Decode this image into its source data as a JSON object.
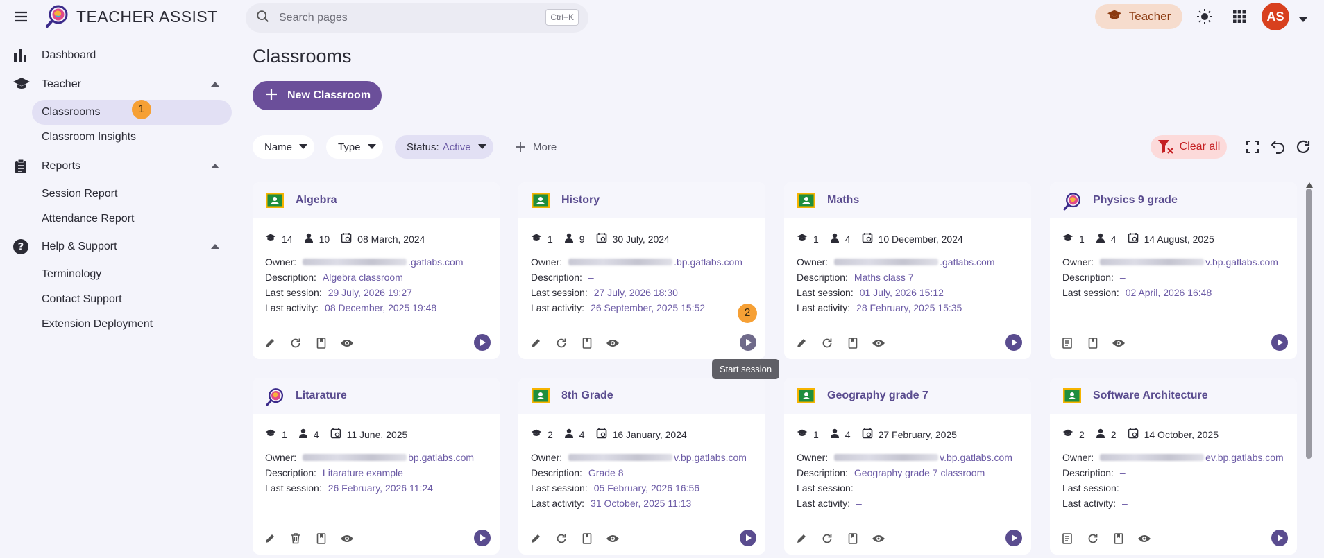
{
  "header": {
    "app_title": "TEACHER ASSIST",
    "search_placeholder": "Search pages",
    "search_shortcut": "Ctrl+K",
    "role_label": "Teacher",
    "avatar_initials": "AS",
    "accent_color": "#6b4f9a",
    "avatar_color": "#d8401e"
  },
  "sidebar": {
    "dashboard": "Dashboard",
    "teacher": "Teacher",
    "classrooms": "Classrooms",
    "classrooms_badge": "1",
    "classroom_insights": "Classroom Insights",
    "reports": "Reports",
    "session_report": "Session Report",
    "attendance_report": "Attendance Report",
    "help": "Help & Support",
    "terminology": "Terminology",
    "contact_support": "Contact Support",
    "extension_deployment": "Extension Deployment"
  },
  "main": {
    "page_title": "Classrooms",
    "new_button": "New Classroom",
    "filters": {
      "name": "Name",
      "type": "Type",
      "status_label": "Status:",
      "status_value": "Active",
      "more": "More",
      "clear_all": "Clear all"
    },
    "tooltip": "Start session",
    "tooltip_badge": "2"
  },
  "labels": {
    "owner": "Owner:",
    "description": "Description:",
    "last_session": "Last session:",
    "last_activity": "Last activity:"
  },
  "cards": [
    {
      "title": "Algebra",
      "type": "google",
      "students": "14",
      "teachers": "10",
      "date": "08 March, 2024",
      "owner_suffix": ".gatlabs.com",
      "description": "Algebra classroom",
      "last_session": "29 July, 2026 19:27",
      "last_activity": "08 December, 2025 19:48",
      "has_activity": true
    },
    {
      "title": "History",
      "type": "google",
      "students": "1",
      "teachers": "9",
      "date": "30 July, 2024",
      "owner_suffix": ".bp.gatlabs.com",
      "description": "–",
      "last_session": "27 July, 2026 18:30",
      "last_activity": "26 September, 2025 15:52",
      "has_activity": true
    },
    {
      "title": "Maths",
      "type": "google",
      "students": "1",
      "teachers": "4",
      "date": "10 December, 2024",
      "owner_suffix": ".gatlabs.com",
      "description": "Maths class 7",
      "last_session": "01 July, 2026 15:12",
      "last_activity": "28 February, 2025 15:35",
      "has_activity": true
    },
    {
      "title": "Physics 9 grade",
      "type": "app",
      "students": "1",
      "teachers": "4",
      "date": "14 August, 2025",
      "owner_suffix": "v.bp.gatlabs.com",
      "description": "–",
      "last_session": "02 April, 2026 16:48",
      "has_activity": false
    },
    {
      "title": "Litarature",
      "type": "app",
      "students": "1",
      "teachers": "4",
      "date": "11 June, 2025",
      "owner_suffix": "bp.gatlabs.com",
      "description": "Litarature example",
      "last_session": "26 February, 2026 11:24",
      "has_activity": false
    },
    {
      "title": "8th Grade",
      "type": "google",
      "students": "2",
      "teachers": "4",
      "date": "16 January, 2024",
      "owner_suffix": "v.bp.gatlabs.com",
      "description": "Grade 8",
      "last_session": "05 February, 2026 16:56",
      "last_activity": "31 October, 2025 11:13",
      "has_activity": true
    },
    {
      "title": "Geography grade 7",
      "type": "google",
      "students": "1",
      "teachers": "4",
      "date": "27 February, 2025",
      "owner_suffix": "v.bp.gatlabs.com",
      "description": "Geography grade 7 classroom",
      "last_session": "–",
      "last_activity": "–",
      "has_activity": true
    },
    {
      "title": "Software Architecture",
      "type": "google",
      "students": "2",
      "teachers": "2",
      "date": "14 October, 2025",
      "owner_suffix": "ev.bp.gatlabs.com",
      "description": "–",
      "last_session": "–",
      "last_activity": "–",
      "has_activity": true
    }
  ]
}
